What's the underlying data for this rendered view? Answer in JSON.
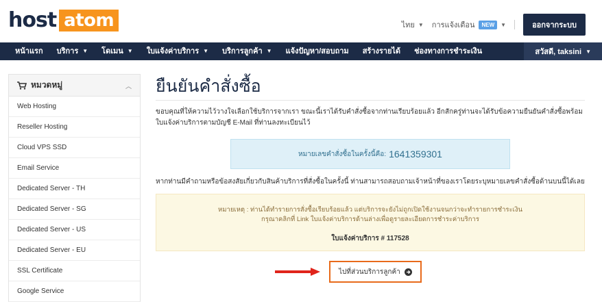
{
  "header": {
    "logo_host": "host",
    "logo_atom": "atom",
    "lang": "ไทย",
    "notifications": "การแจ้งเตือน",
    "new_badge": "NEW",
    "logout": "ออกจากระบบ"
  },
  "nav": {
    "items": [
      {
        "label": "หน้าแรก",
        "caret": false
      },
      {
        "label": "บริการ",
        "caret": true
      },
      {
        "label": "โดเมน",
        "caret": true
      },
      {
        "label": "ใบแจ้งค่าบริการ",
        "caret": true
      },
      {
        "label": "บริการลูกค้า",
        "caret": true
      },
      {
        "label": "แจ้งปัญหา/สอบถาม",
        "caret": false
      },
      {
        "label": "สร้างรายได้",
        "caret": false
      },
      {
        "label": "ช่องทางการชำระเงิน",
        "caret": false
      }
    ],
    "user": "สวัสดี, taksini"
  },
  "sidebar": {
    "title": "หมวดหมู่",
    "items": [
      "Web Hosting",
      "Reseller Hosting",
      "Cloud VPS SSD",
      "Email Service",
      "Dedicated Server - TH",
      "Dedicated Server - SG",
      "Dedicated Server - US",
      "Dedicated Server - EU",
      "SSL Certificate",
      "Google Service"
    ]
  },
  "main": {
    "title": "ยืนยันคำสั่งซื้อ",
    "thanks": "ขอบคุณที่ให้ความไว้วางใจเลือกใช้บริการจากเรา ขณะนี้เราได้รับคำสั่งซื้อจากท่านเรียบร้อยแล้ว อีกสักครู่ท่านจะได้รับข้อความยืนยันคำสั่งซื้อพร้อมใบแจ้งค่าบริการตามบัญชี E-Mail ที่ท่านลงทะเบียนไว้",
    "order_label": "หมายเลขคำสั่งซื้อในครั้งนี้คือ:",
    "order_number": "1641359301",
    "question": "หากท่านมีคำถามหรือข้อสงสัยเกี่ยวกับสินค้าบริการที่สั่งซื้อในครั้งนี้ ท่านสามารถสอบถามเจ้าหน้าที่ของเราโดยระบุหมายเลขคำสั่งซื้อด้านบนนี้ได้เลย",
    "notice_line1": "หมายเหตุ : ท่านได้ทำรายการสั่งซื้อเรียบร้อยแล้ว แต่บริการจะยังไม่ถูกเปิดใช้งานจนกว่าจะทำรายการชำระเงิน",
    "notice_line2": "กรุณาคลิกที่ Link ใบแจ้งค่าบริการด้านล่างเพื่อดูรายละเอียดการชำระค่าบริการ",
    "invoice_link": "ใบแจ้งค่าบริการ # 117528",
    "cta": "ไปที่ส่วนบริการลูกค้า"
  },
  "colors": {
    "brand_navy": "#1c2b46",
    "brand_orange": "#f7941d",
    "highlight": "#e86a1a",
    "arrow": "#e0241b"
  }
}
